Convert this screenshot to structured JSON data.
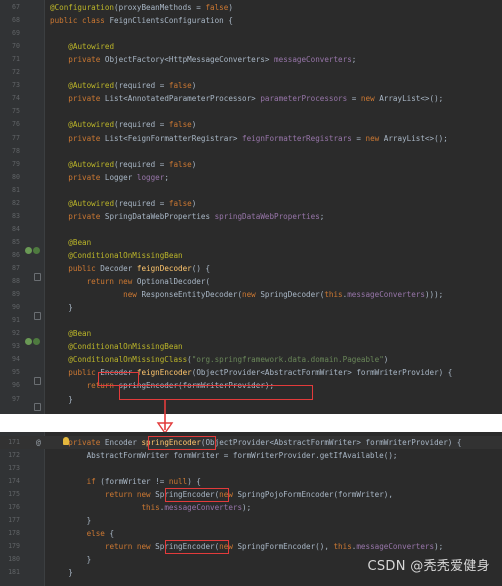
{
  "editor_top": {
    "lines": [
      {
        "no": "67",
        "html": "<span class='an'>@Configuration</span>(proxyBeanMethods = <span class='kw'>false</span>)"
      },
      {
        "no": "68",
        "html": "<span class='kw'>public class</span> FeignClientsConfiguration {"
      },
      {
        "no": "69",
        "html": ""
      },
      {
        "no": "70",
        "html": "    <span class='an'>@Autowired</span>"
      },
      {
        "no": "71",
        "html": "    <span class='kw'>private</span> ObjectFactory&lt;HttpMessageConverters&gt; <span class='fd'>messageConverters</span>;"
      },
      {
        "no": "72",
        "html": ""
      },
      {
        "no": "73",
        "html": "    <span class='an'>@Autowired</span>(required = <span class='kw'>false</span>)"
      },
      {
        "no": "74",
        "html": "    <span class='kw'>private</span> List&lt;AnnotatedParameterProcessor&gt; <span class='fd'>parameterProcessors</span> = <span class='kw'>new</span> ArrayList&lt;&gt;();"
      },
      {
        "no": "75",
        "html": ""
      },
      {
        "no": "76",
        "html": "    <span class='an'>@Autowired</span>(required = <span class='kw'>false</span>)"
      },
      {
        "no": "77",
        "html": "    <span class='kw'>private</span> List&lt;FeignFormatterRegistrar&gt; <span class='fd'>feignFormatterRegistrars</span> = <span class='kw'>new</span> ArrayList&lt;&gt;();"
      },
      {
        "no": "78",
        "html": ""
      },
      {
        "no": "79",
        "html": "    <span class='an'>@Autowired</span>(required = <span class='kw'>false</span>)"
      },
      {
        "no": "80",
        "html": "    <span class='kw'>private</span> Logger <span class='fd'>logger</span>;"
      },
      {
        "no": "81",
        "html": ""
      },
      {
        "no": "82",
        "html": "    <span class='an'>@Autowired</span>(required = <span class='kw'>false</span>)"
      },
      {
        "no": "83",
        "html": "    <span class='kw'>private</span> SpringDataWebProperties <span class='fd'>springDataWebProperties</span>;"
      },
      {
        "no": "84",
        "html": ""
      },
      {
        "no": "85",
        "html": "    <span class='an'>@Bean</span>"
      },
      {
        "no": "86",
        "html": "    <span class='an'>@ConditionalOnMissingBean</span>"
      },
      {
        "no": "87",
        "html": "    <span class='kw'>public</span> Decoder <span class='fn'>feignDecoder</span>() {"
      },
      {
        "no": "88",
        "html": "        <span class='kw'>return new</span> OptionalDecoder("
      },
      {
        "no": "89",
        "html": "                <span class='kw'>new</span> ResponseEntityDecoder(<span class='kw'>new</span> SpringDecoder(<span class='kw'>this</span>.<span class='fd'>messageConverters</span>)));"
      },
      {
        "no": "90",
        "html": "    }"
      },
      {
        "no": "91",
        "html": ""
      },
      {
        "no": "92",
        "html": "    <span class='an'>@Bean</span>"
      },
      {
        "no": "93",
        "html": "    <span class='an'>@ConditionalOnMissingBean</span>"
      },
      {
        "no": "94",
        "html": "    <span class='an'>@ConditionalOnMissingClass</span>(<span class='st'>\"org.springframework.data.domain.Pageable\"</span>)"
      },
      {
        "no": "95",
        "html": "    <span class='kw'>public</span> Encoder <span class='fn'>feignEncoder</span>(ObjectProvider&lt;AbstractFormWriter&gt; formWriterProvider) {"
      },
      {
        "no": "96",
        "html": "        <span class='kw'>return</span> springEncoder(formWriterProvider);"
      },
      {
        "no": "97",
        "html": "    }"
      }
    ]
  },
  "editor_bottom": {
    "lines": [
      {
        "no": "171",
        "html": "    <span class='kw'>private</span> Encoder <span class='fn'>springEncoder</span>(ObjectProvider&lt;AbstractFormWriter&gt; formWriterProvider) {"
      },
      {
        "no": "172",
        "html": "        AbstractFormWriter formWriter = formWriterProvider.getIfAvailable();"
      },
      {
        "no": "173",
        "html": ""
      },
      {
        "no": "174",
        "html": "        <span class='kw'>if</span> (formWriter != <span class='kw'>null</span>) {"
      },
      {
        "no": "175",
        "html": "            <span class='kw'>return new</span> SpringEncoder(<span class='kw'>new</span> SpringPojoFormEncoder(formWriter),"
      },
      {
        "no": "176",
        "html": "                    <span class='kw'>this</span>.<span class='fd'>messageConverters</span>);"
      },
      {
        "no": "177",
        "html": "        }"
      },
      {
        "no": "178",
        "html": "        <span class='kw'>else</span> {"
      },
      {
        "no": "179",
        "html": "            <span class='kw'>return new</span> SpringEncoder(<span class='kw'>new</span> SpringFormEncoder(), <span class='kw'>this</span>.<span class='fd'>messageConverters</span>);"
      },
      {
        "no": "180",
        "html": "        }"
      },
      {
        "no": "181",
        "html": "    }"
      }
    ]
  },
  "watermark": "CSDN @秃秃爱健身",
  "colors": {
    "highlight": "#e23b3b",
    "editor_bg": "#2b2b2b",
    "gutter_bg": "#313335"
  },
  "icons": [
    "bean-gutter-icon",
    "intention-bulb-icon",
    "override-marker-icon",
    "fold-marker-icon"
  ]
}
